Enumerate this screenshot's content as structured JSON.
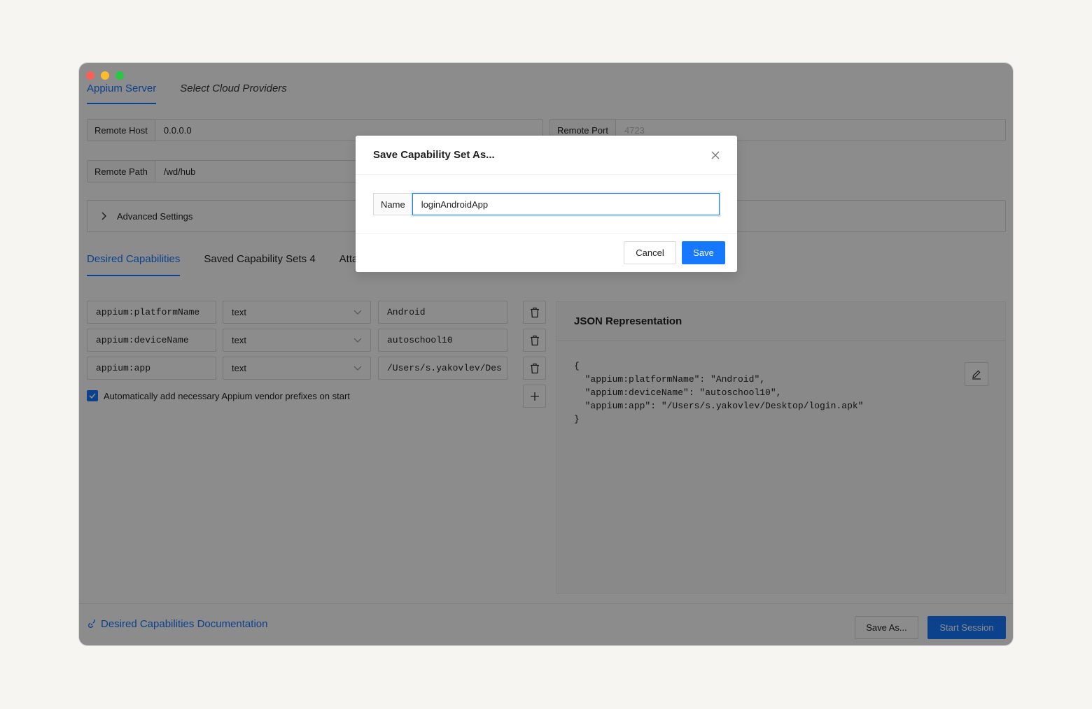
{
  "top_tabs": {
    "server": "Appium Server",
    "cloud": "Select Cloud Providers"
  },
  "server": {
    "remote_host_label": "Remote Host",
    "remote_host_value": "0.0.0.0",
    "remote_port_label": "Remote Port",
    "remote_port_placeholder": "4723",
    "remote_path_label": "Remote Path",
    "remote_path_value": "/wd/hub",
    "advanced_settings": "Advanced Settings"
  },
  "cap_tabs": {
    "desired": "Desired Capabilities",
    "saved": "Saved Capability Sets 4",
    "attach": "Atta"
  },
  "capabilities": [
    {
      "name": "appium:platformName",
      "type": "text",
      "value": "Android"
    },
    {
      "name": "appium:deviceName",
      "type": "text",
      "value": "autoschool10"
    },
    {
      "name": "appium:app",
      "type": "text",
      "value": "/Users/s.yakovlev/Des"
    }
  ],
  "checkbox_label": "Automatically add necessary Appium vendor prefixes on start",
  "json_panel": {
    "title": "JSON Representation",
    "code": "{\n  \"appium:platformName\": \"Android\",\n  \"appium:deviceName\": \"autoschool10\",\n  \"appium:app\": \"/Users/s.yakovlev/Desktop/login.apk\"\n}"
  },
  "footer": {
    "doc_link": "Desired Capabilities Documentation",
    "save_as": "Save As...",
    "start_session": "Start Session"
  },
  "modal": {
    "title": "Save Capability Set As...",
    "name_label": "Name",
    "name_value": "loginAndroidApp",
    "cancel": "Cancel",
    "save": "Save"
  },
  "colors": {
    "accent": "#1677ff",
    "overlay": "rgba(0,0,0,0.45)"
  }
}
